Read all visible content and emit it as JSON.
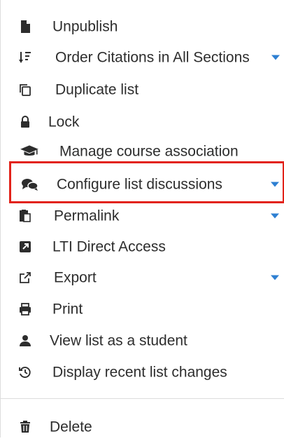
{
  "menu": {
    "items": [
      {
        "label": "Unpublish",
        "icon": "file-icon"
      },
      {
        "label": "Order Citations in All Sections",
        "icon": "sort-icon",
        "has_submenu": true
      },
      {
        "label": "Duplicate list",
        "icon": "copy-icon"
      },
      {
        "label": "Lock",
        "icon": "lock-icon"
      },
      {
        "label": "Manage course association",
        "icon": "graduation-cap-icon"
      },
      {
        "label": "Configure list discussions",
        "icon": "comments-icon",
        "has_submenu": true,
        "highlighted": true
      },
      {
        "label": "Permalink",
        "icon": "clipboard-icon",
        "has_submenu": true
      },
      {
        "label": "LTI Direct Access",
        "icon": "external-square-icon"
      },
      {
        "label": "Export",
        "icon": "export-icon",
        "has_submenu": true
      },
      {
        "label": "Print",
        "icon": "print-icon"
      },
      {
        "label": "View list as a student",
        "icon": "user-icon"
      },
      {
        "label": "Display recent list changes",
        "icon": "history-icon"
      },
      {
        "label": "Delete",
        "icon": "trash-icon"
      }
    ]
  },
  "colors": {
    "caret": "#2d7fd2",
    "highlight_border": "#e2231a",
    "text": "#2d2d2d"
  }
}
